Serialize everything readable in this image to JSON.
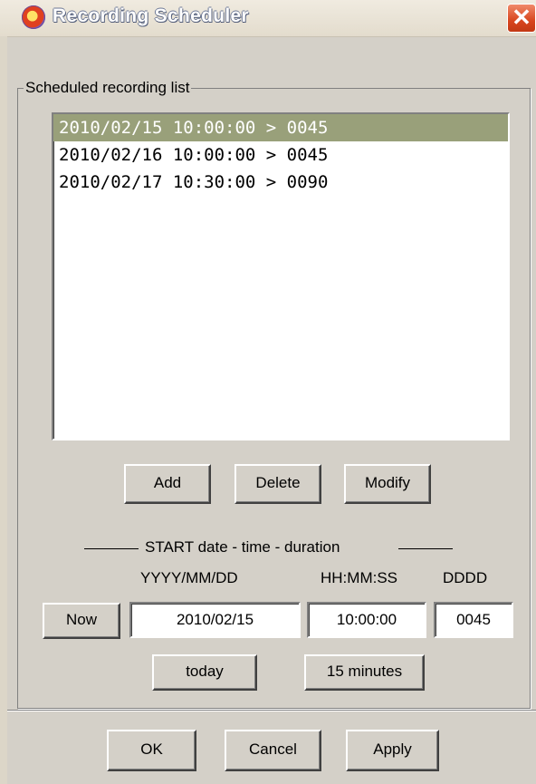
{
  "window": {
    "title": "Recording Scheduler",
    "close_glyph": "✕",
    "icon": "app-record-icon"
  },
  "scheduled": {
    "legend": "Scheduled recording list",
    "items": [
      {
        "text": "2010/02/15 10:00:00 > 0045",
        "selected": true
      },
      {
        "text": "2010/02/16 10:00:00 > 0045",
        "selected": false
      },
      {
        "text": "2010/02/17 10:30:00 > 0090",
        "selected": false
      }
    ],
    "add_label": "Add",
    "delete_label": "Delete",
    "modify_label": "Modify"
  },
  "start": {
    "section_title": "START date - time - duration",
    "date_header": "YYYY/MM/DD",
    "time_header": "HH:MM:SS",
    "duration_header": "DDDD",
    "now_label": "Now",
    "date_value": "2010/02/15",
    "time_value": "10:00:00",
    "duration_value": "0045",
    "today_label": "today",
    "minutes_label": "15 minutes"
  },
  "footer": {
    "ok_label": "OK",
    "cancel_label": "Cancel",
    "apply_label": "Apply"
  },
  "colors": {
    "dialog_bg": "#d4d0c8",
    "selection_bg": "#99a07a",
    "close_button": "#d8461e"
  }
}
